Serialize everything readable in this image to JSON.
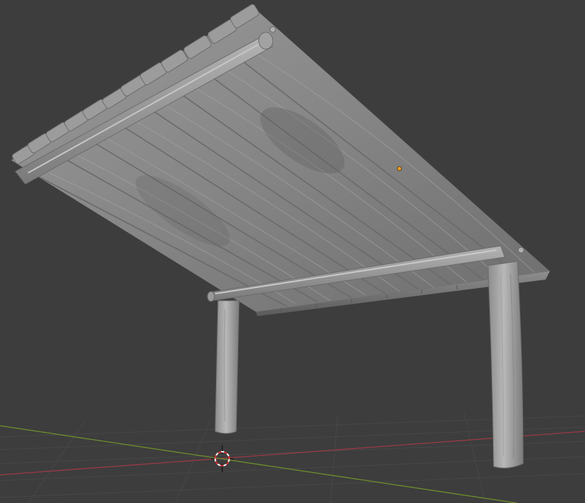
{
  "app": "Blender",
  "viewport": {
    "background_color": "#3d3d3d",
    "grid_color": "#474747",
    "x_axis_color": "#9a3a45",
    "y_axis_color": "#6f8f2c",
    "mesh_color": "#8a8a8a",
    "origin_marker_color": "#f0a020"
  },
  "scene": {
    "object": "wooden-shelter-mesh",
    "origin_marker": "object-origin",
    "cursor": "3d-cursor"
  }
}
